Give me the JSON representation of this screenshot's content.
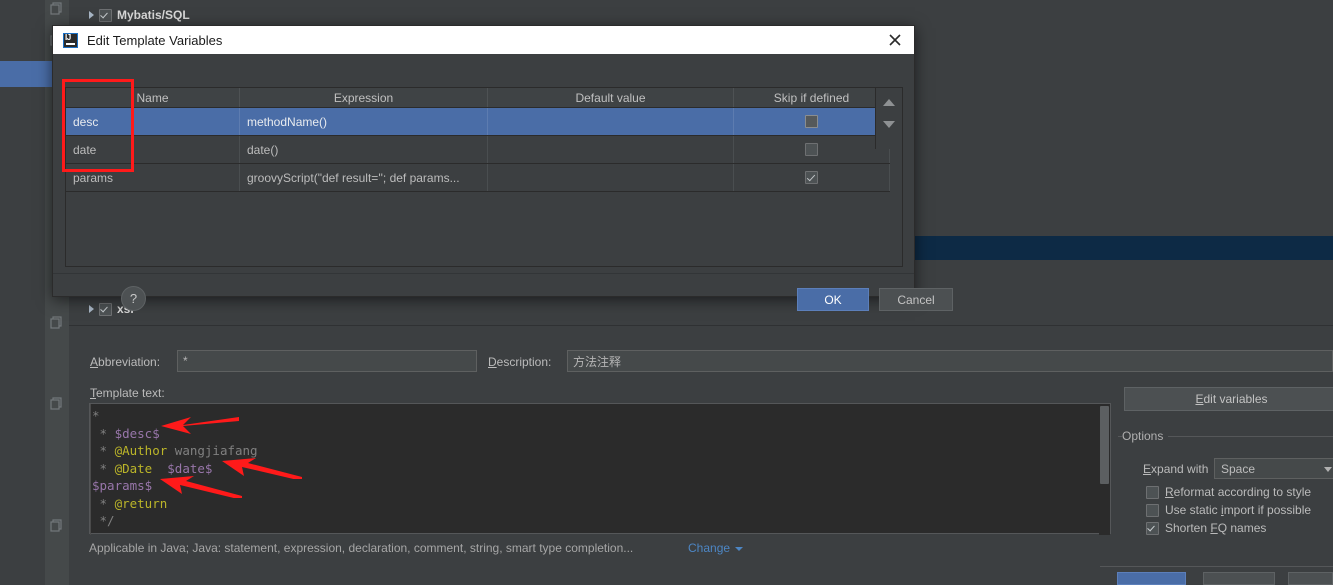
{
  "background": {
    "tree_items": [
      {
        "label": "Mybatis/SQL",
        "checked": true
      },
      {
        "label": "xsl",
        "checked": true
      }
    ],
    "fields": {
      "abbreviation_label": "Abbreviation:",
      "abbreviation_value": "*",
      "description_label": "Description:",
      "description_value": "方法注释",
      "template_text_label": "Template text:"
    },
    "template_code": {
      "lines": [
        [
          {
            "t": "*",
            "c": "c-com"
          }
        ],
        [
          {
            "t": " * ",
            "c": "c-com"
          },
          {
            "t": "$desc$",
            "c": "c-var"
          }
        ],
        [
          {
            "t": " * ",
            "c": "c-com"
          },
          {
            "t": "@Author",
            "c": "c-tag"
          },
          {
            "t": " wangjiafang",
            "c": "c-com"
          }
        ],
        [
          {
            "t": " * ",
            "c": "c-com"
          },
          {
            "t": "@Date",
            "c": "c-tag"
          },
          {
            "t": "  ",
            "c": "c-com"
          },
          {
            "t": "$date$",
            "c": "c-var"
          }
        ],
        [
          {
            "t": "$params$",
            "c": "c-var"
          }
        ],
        [
          {
            "t": " * ",
            "c": "c-com"
          },
          {
            "t": "@return",
            "c": "c-tag"
          }
        ],
        [
          {
            "t": " */",
            "c": "c-com"
          }
        ]
      ]
    },
    "options": {
      "edit_variables_label": "Edit variables",
      "legend": "Options",
      "expand_with_label": "Expand with",
      "expand_with_value": "Space",
      "checkboxes": [
        {
          "label": "Reformat according to style",
          "checked": false
        },
        {
          "label": "Use static import if possible",
          "checked": false
        },
        {
          "label": "Shorten FQ names",
          "checked": true
        }
      ]
    },
    "status": {
      "text": "Applicable in Java; Java: statement, expression, declaration, comment, string, smart type completion...",
      "change_link": "Change"
    }
  },
  "dialog": {
    "title": "Edit Template Variables",
    "icon": "intellij-idea-icon",
    "close_icon": "close-icon",
    "help_label": "?",
    "buttons": {
      "ok": "OK",
      "cancel": "Cancel"
    },
    "table": {
      "columns": [
        "Name",
        "Expression",
        "Default value",
        "Skip if defined"
      ],
      "rows": [
        {
          "name": "desc",
          "expression": "methodName()",
          "default_value": "",
          "skip_if_defined": "pressed",
          "selected": true
        },
        {
          "name": "date",
          "expression": "date()",
          "default_value": "",
          "skip_if_defined": "unchecked",
          "selected": false
        },
        {
          "name": "params",
          "expression": "groovyScript(\"def result=''; def params...",
          "default_value": "",
          "skip_if_defined": "checked",
          "selected": false
        }
      ]
    }
  },
  "annotations": {
    "highlight_color": "#ff1a1a",
    "rect_target": "name-column-cells",
    "arrows": [
      "points-to-$desc$",
      "points-to-$date$",
      "points-to-$params$"
    ]
  },
  "colors": {
    "accent_blue": "#4a6da7",
    "link_blue": "#4d86c4",
    "panel_bg": "#3c3f41",
    "editor_bg": "#2b2b2b",
    "variable_purple": "#9876aa",
    "tag_yellow": "#bbb529",
    "comment_gray": "#808080"
  }
}
